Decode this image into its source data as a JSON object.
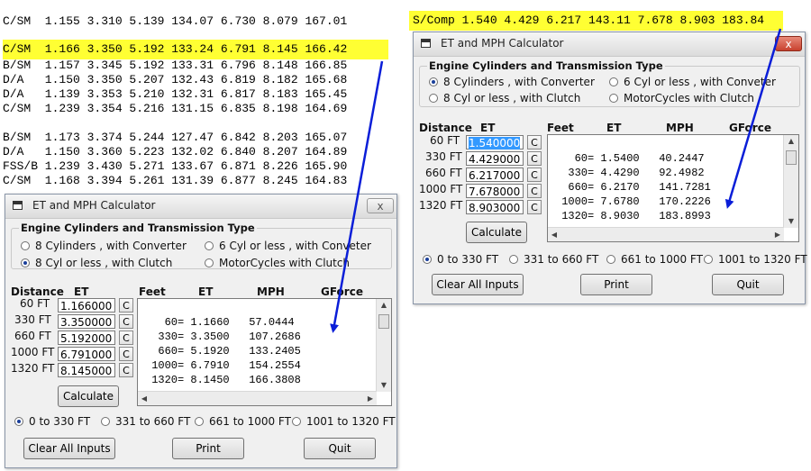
{
  "background_text": {
    "lines": [
      "C/SM  1.155 3.310 5.139 134.07 6.730 8.079 167.01",
      "C/SM  1.166 3.350 5.192 133.24 6.791 8.145 166.42",
      "B/SM  1.157 3.345 5.192 133.31 6.796 8.148 166.85",
      "D/A   1.150 3.350 5.207 132.43 6.819 8.182 165.68",
      "D/A   1.139 3.353 5.210 132.31 6.817 8.183 165.45",
      "C/SM  1.239 3.354 5.216 131.15 6.835 8.198 164.69",
      "B/SM  1.173 3.374 5.244 127.47 6.842 8.203 165.07",
      "D/A   1.150 3.360 5.223 132.02 6.840 8.207 164.89",
      "FSS/B 1.239 3.430 5.271 133.67 6.871 8.226 165.90",
      "C/SM  1.168 3.394 5.261 131.39 6.877 8.245 164.83"
    ],
    "top_line": "S/Comp 1.540 4.429 6.217 143.11 7.678 8.903 183.84"
  },
  "colors": {
    "highlight": "#ffff33",
    "arrow": "#0a1ed8",
    "selection": "#3399ff"
  },
  "win1": {
    "title": "ET and MPH Calculator",
    "group_title": "Engine Cylinders  and  Transmission Type",
    "radios": [
      "8 Cylinders , with Converter",
      "6 Cyl or less , with Conveter",
      "8 Cyl or less , with Clutch",
      "MotorCycles with Clutch"
    ],
    "selected_radio": "8 Cyl or less , with Clutch",
    "hdr_distance": "Distance",
    "hdr_et": "ET",
    "rows": [
      {
        "label": "60 FT",
        "value": "1.166000"
      },
      {
        "label": "330 FT",
        "value": "3.350000"
      },
      {
        "label": "660 FT",
        "value": "5.192000"
      },
      {
        "label": "1000 FT",
        "value": "6.791000"
      },
      {
        "label": "1320 FT",
        "value": "8.145000"
      }
    ],
    "c_label": "C",
    "hdr_feet": "Feet",
    "hdr_et2": "ET",
    "hdr_mph": "MPH",
    "hdr_gforce": "GForce",
    "output": "\n   60= 1.1660   57.0444\n  330= 3.3500   107.2686\n  660= 5.1920   133.2405\n 1000= 6.7910   154.2554\n 1320= 8.1450   166.3808",
    "calculate": "Calculate",
    "ranges": [
      "0  to 330 FT",
      "331 to 660 FT",
      "661 to 1000 FT",
      "1001 to 1320 FT"
    ],
    "selected_range": "0  to 330 FT",
    "clear": "Clear All Inputs",
    "print": "Print",
    "quit": "Quit",
    "close": "x"
  },
  "win2": {
    "title": "ET and MPH Calculator",
    "group_title": "Engine Cylinders  and  Transmission Type",
    "radios": [
      "8 Cylinders , with Converter",
      "6 Cyl or less , with Conveter",
      "8 Cyl or less , with Clutch",
      "MotorCycles with Clutch"
    ],
    "selected_radio": "8 Cylinders , with Converter",
    "hdr_distance": "Distance",
    "hdr_et": "ET",
    "rows": [
      {
        "label": "60 FT",
        "value": "1.540000"
      },
      {
        "label": "330 FT",
        "value": "4.429000"
      },
      {
        "label": "660 FT",
        "value": "6.217000"
      },
      {
        "label": "1000 FT",
        "value": "7.678000"
      },
      {
        "label": "1320 FT",
        "value": "8.903000"
      }
    ],
    "c_label": "C",
    "hdr_feet": "Feet",
    "hdr_et2": "ET",
    "hdr_mph": "MPH",
    "hdr_gforce": "GForce",
    "output": "\n   60= 1.5400   40.2447\n  330= 4.4290   92.4982\n  660= 6.2170   141.7281\n 1000= 7.6780   170.2226\n 1320= 8.9030   183.8993",
    "calculate": "Calculate",
    "ranges": [
      "0  to 330 FT",
      "331 to 660 FT",
      "661 to 1000 FT",
      "1001 to 1320 FT"
    ],
    "selected_range": "0  to 330 FT",
    "clear": "Clear All Inputs",
    "print": "Print",
    "quit": "Quit",
    "close": "x"
  }
}
